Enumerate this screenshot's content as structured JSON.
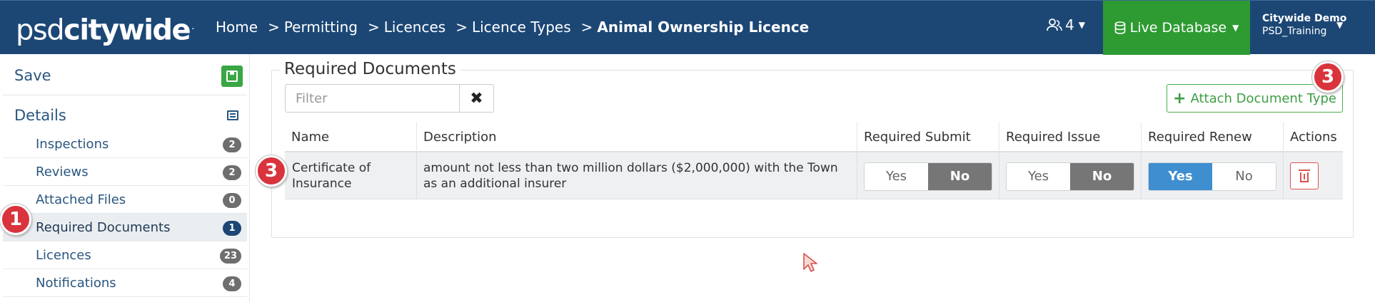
{
  "app": {
    "logo_left": "psd",
    "logo_right": "citywide",
    "logo_mark": "."
  },
  "breadcrumb": [
    {
      "label": "Home"
    },
    {
      "label": "Permitting"
    },
    {
      "label": "Licences"
    },
    {
      "label": "Licence Types"
    },
    {
      "label": "Animal Ownership Licence"
    }
  ],
  "breadcrumb_separator": ">",
  "topbar": {
    "users_count": "4",
    "database_label": "Live Database",
    "user_name": "Citywide Demo",
    "user_org": "PSD_Training"
  },
  "sidebar": {
    "save_label": "Save",
    "details_label": "Details",
    "items": [
      {
        "label": "Inspections",
        "count": "2"
      },
      {
        "label": "Reviews",
        "count": "2"
      },
      {
        "label": "Attached Files",
        "count": "0"
      },
      {
        "label": "Required Documents",
        "count": "1"
      },
      {
        "label": "Licences",
        "count": "23"
      },
      {
        "label": "Notifications",
        "count": "4"
      }
    ]
  },
  "markers": {
    "sidebar": "1",
    "row": "3",
    "attach": "3"
  },
  "section": {
    "title": "Required Documents",
    "filter_placeholder": "Filter",
    "filter_value": "",
    "attach_label": "Attach Document Type"
  },
  "table": {
    "columns": [
      "Name",
      "Description",
      "Required Submit",
      "Required Issue",
      "Required Renew",
      "Actions"
    ],
    "rows": [
      {
        "name": "Certificate of Insurance",
        "description": "amount not less than two million dollars ($2,000,000) with the Town as an additional insurer",
        "yes_label": "Yes",
        "no_label": "No",
        "required_submit": "No",
        "required_issue": "No",
        "required_renew": "Yes"
      }
    ]
  },
  "colors": {
    "navbar": "#1c4775",
    "database_green": "#2d9b32",
    "link_blue": "#2a5680",
    "toggle_selected_gray": "#767676",
    "toggle_selected_blue": "#3e8ed0",
    "marker_red": "#d9343d",
    "delete_red": "#d9534f"
  },
  "icons": {
    "users": "users-icon",
    "database": "database-icon",
    "save": "save-icon",
    "details": "list-icon",
    "clear": "close-icon",
    "attach": "plus-icon",
    "delete": "trash-icon"
  }
}
